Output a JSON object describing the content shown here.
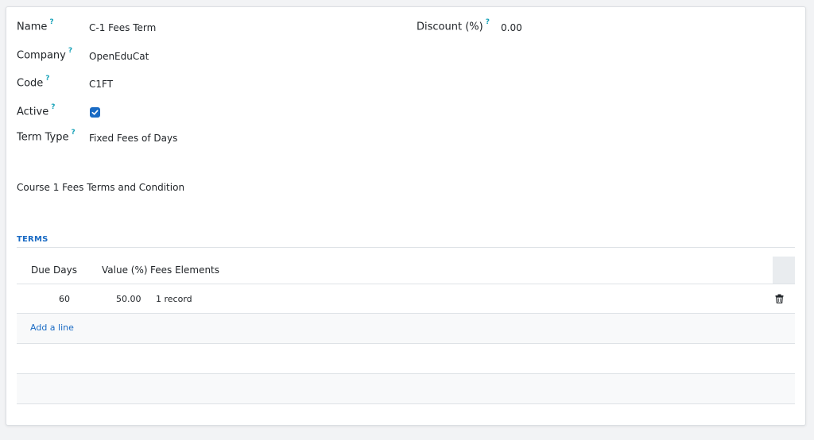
{
  "form": {
    "name_label": "Name",
    "name_value": "C-1 Fees Term",
    "company_label": "Company",
    "company_value": "OpenEduCat",
    "code_label": "Code",
    "code_value": "C1FT",
    "active_label": "Active",
    "active_checked": true,
    "term_type_label": "Term Type",
    "term_type_value": "Fixed Fees of Days",
    "discount_label": "Discount (%)",
    "discount_value": "0.00",
    "help_mark": "?",
    "description": "Course 1 Fees Terms and Condition"
  },
  "terms": {
    "section_title": "TERMS",
    "columns": [
      "Due Days",
      "Value (%)",
      "Fees Elements"
    ],
    "rows": [
      {
        "due_days": "60",
        "value": "50.00",
        "fees_elements": "1 record"
      }
    ],
    "add_line_label": "Add a line"
  },
  "colors": {
    "accent": "#1a6bc4",
    "help": "#17a2b8"
  },
  "icons": {
    "delete": "trash-icon",
    "checkbox": "check-icon"
  }
}
